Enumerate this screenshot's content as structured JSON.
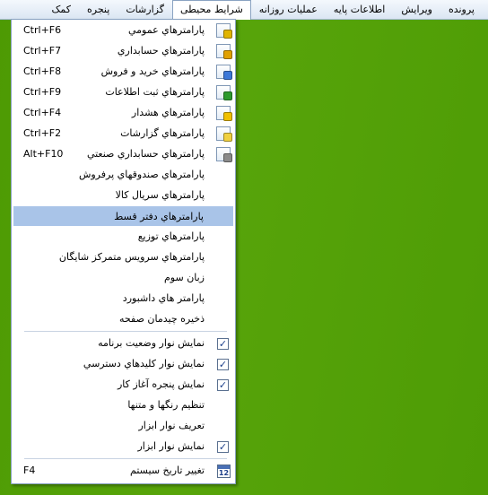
{
  "menubar": {
    "items": [
      "پرونده",
      "ویرایش",
      "اطلاعات پایه",
      "عملیات روزانه",
      "شرایط محیطی",
      "گزارشات",
      "پنجره",
      "کمک"
    ],
    "active": "شرایط محیطی"
  },
  "dropdown": {
    "items": [
      {
        "label": "پارامترهاي عمومي",
        "shortcut": "Ctrl+F6",
        "icon": "settings-doc-icon",
        "badge": "#e0b400"
      },
      {
        "label": "پارامترهاي حسابداري",
        "shortcut": "Ctrl+F7",
        "icon": "accounting-doc-icon",
        "badge": "#e0a000"
      },
      {
        "label": "پارامترهاي خريد و فروش",
        "shortcut": "Ctrl+F8",
        "icon": "sales-doc-icon",
        "badge": "#3c78d8"
      },
      {
        "label": "پارامترهاي ثبت اطلاعات",
        "shortcut": "Ctrl+F9",
        "icon": "data-entry-doc-icon",
        "badge": "#2e9a2e"
      },
      {
        "label": "پارامترهاي هشدار",
        "shortcut": "Ctrl+F4",
        "icon": "warning-doc-icon",
        "badge": "#f0c000"
      },
      {
        "label": "پارامترهاي گزارشات",
        "shortcut": "Ctrl+F2",
        "icon": "reports-doc-icon",
        "badge": "#f0d040"
      },
      {
        "label": "پارامترهاي حسابداري صنعتي",
        "shortcut": "Alt+F10",
        "icon": "industrial-gear-icon",
        "badge": "#8a8a8a"
      },
      {
        "label": "پارامترهاي صندوقهاي پرفروش",
        "shortcut": ""
      },
      {
        "label": "پارامترهاي سريال کالا",
        "shortcut": ""
      },
      {
        "label": "پارامترهاي دفتر قسط",
        "shortcut": "",
        "highlighted": true
      },
      {
        "label": "پارامترهاي توزيع",
        "shortcut": ""
      },
      {
        "label": "پارامترهاي سرويس متمرکز شايگان",
        "shortcut": ""
      },
      {
        "label": "زبان سوم",
        "shortcut": ""
      },
      {
        "label": "پارامتر هاي داشبورد",
        "shortcut": ""
      },
      {
        "label": "ذخيره چيدمان صفحه",
        "shortcut": ""
      },
      {
        "label": "نمايش نوار وضعيت برنامه",
        "shortcut": "",
        "checked": true
      },
      {
        "label": "نمايش نوار کليدهاي دسترسي",
        "shortcut": "",
        "checked": true
      },
      {
        "label": "نمايش پنجره آغاز کار",
        "shortcut": "",
        "checked": true
      },
      {
        "label": "تنظيم رنگها و متنها",
        "shortcut": ""
      },
      {
        "label": "تعريف نوار ابزار",
        "shortcut": ""
      },
      {
        "label": "نمايش نوار ابزار",
        "shortcut": "",
        "checked": true
      },
      {
        "label": "تغيير تاريخ سيستم",
        "shortcut": "F4",
        "icon": "calendar-icon",
        "calendar_text": "12"
      }
    ]
  },
  "colors": {
    "highlight": "#a9c4e8",
    "desktop": "#53a006"
  }
}
